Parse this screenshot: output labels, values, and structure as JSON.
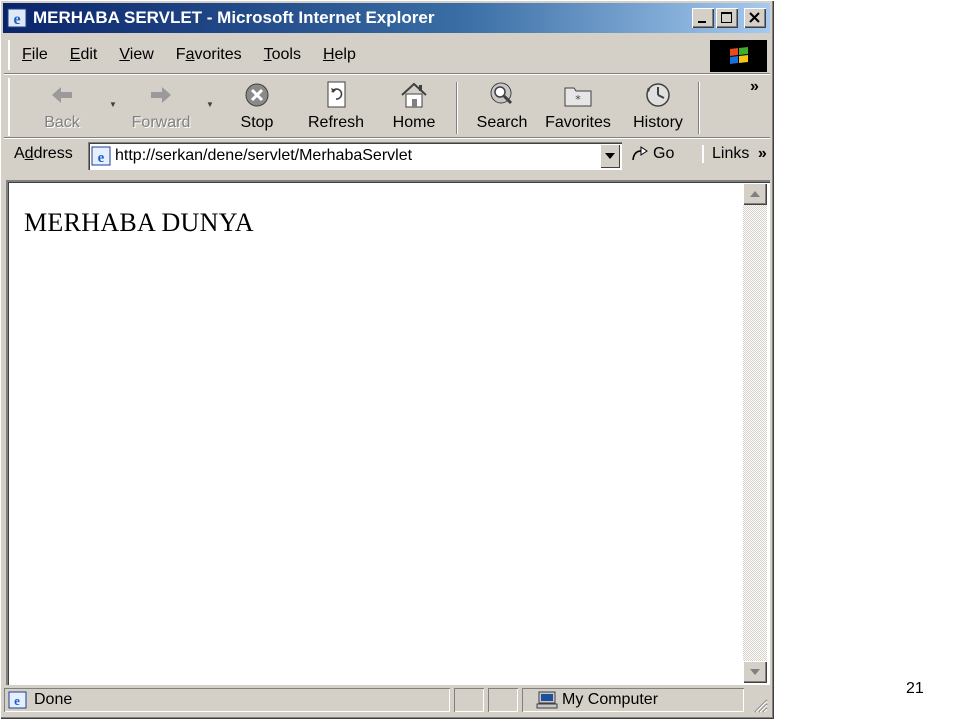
{
  "window": {
    "title": "MERHABA SERVLET - Microsoft Internet Explorer",
    "title_bar_color": "#0a246a",
    "controls": [
      "minimize-icon",
      "maximize-icon",
      "close-icon"
    ]
  },
  "menubar": {
    "items": [
      {
        "underline": "F",
        "rest": "ile"
      },
      {
        "underline": "E",
        "rest": "dit"
      },
      {
        "underline": "V",
        "rest": "iew"
      },
      {
        "pre": "F",
        "underline": "a",
        "rest": "vorites"
      },
      {
        "underline": "T",
        "rest": "ools"
      },
      {
        "underline": "H",
        "rest": "elp"
      }
    ]
  },
  "toolbar": {
    "back": "Back",
    "forward": "Forward",
    "stop": "Stop",
    "refresh": "Refresh",
    "home": "Home",
    "search": "Search",
    "favorites": "Favorites",
    "history": "History",
    "more": "»"
  },
  "address": {
    "label_pre": "A",
    "label_ul": "d",
    "label_rest": "dress",
    "url": "http://serkan/dene/servlet/MerhabaServlet",
    "go": "Go",
    "links": "Links",
    "links_more": "»"
  },
  "page": {
    "heading": "MERHABA DUNYA"
  },
  "statusbar": {
    "status": "Done",
    "zone": "My Computer"
  },
  "slide": {
    "number": "21"
  }
}
